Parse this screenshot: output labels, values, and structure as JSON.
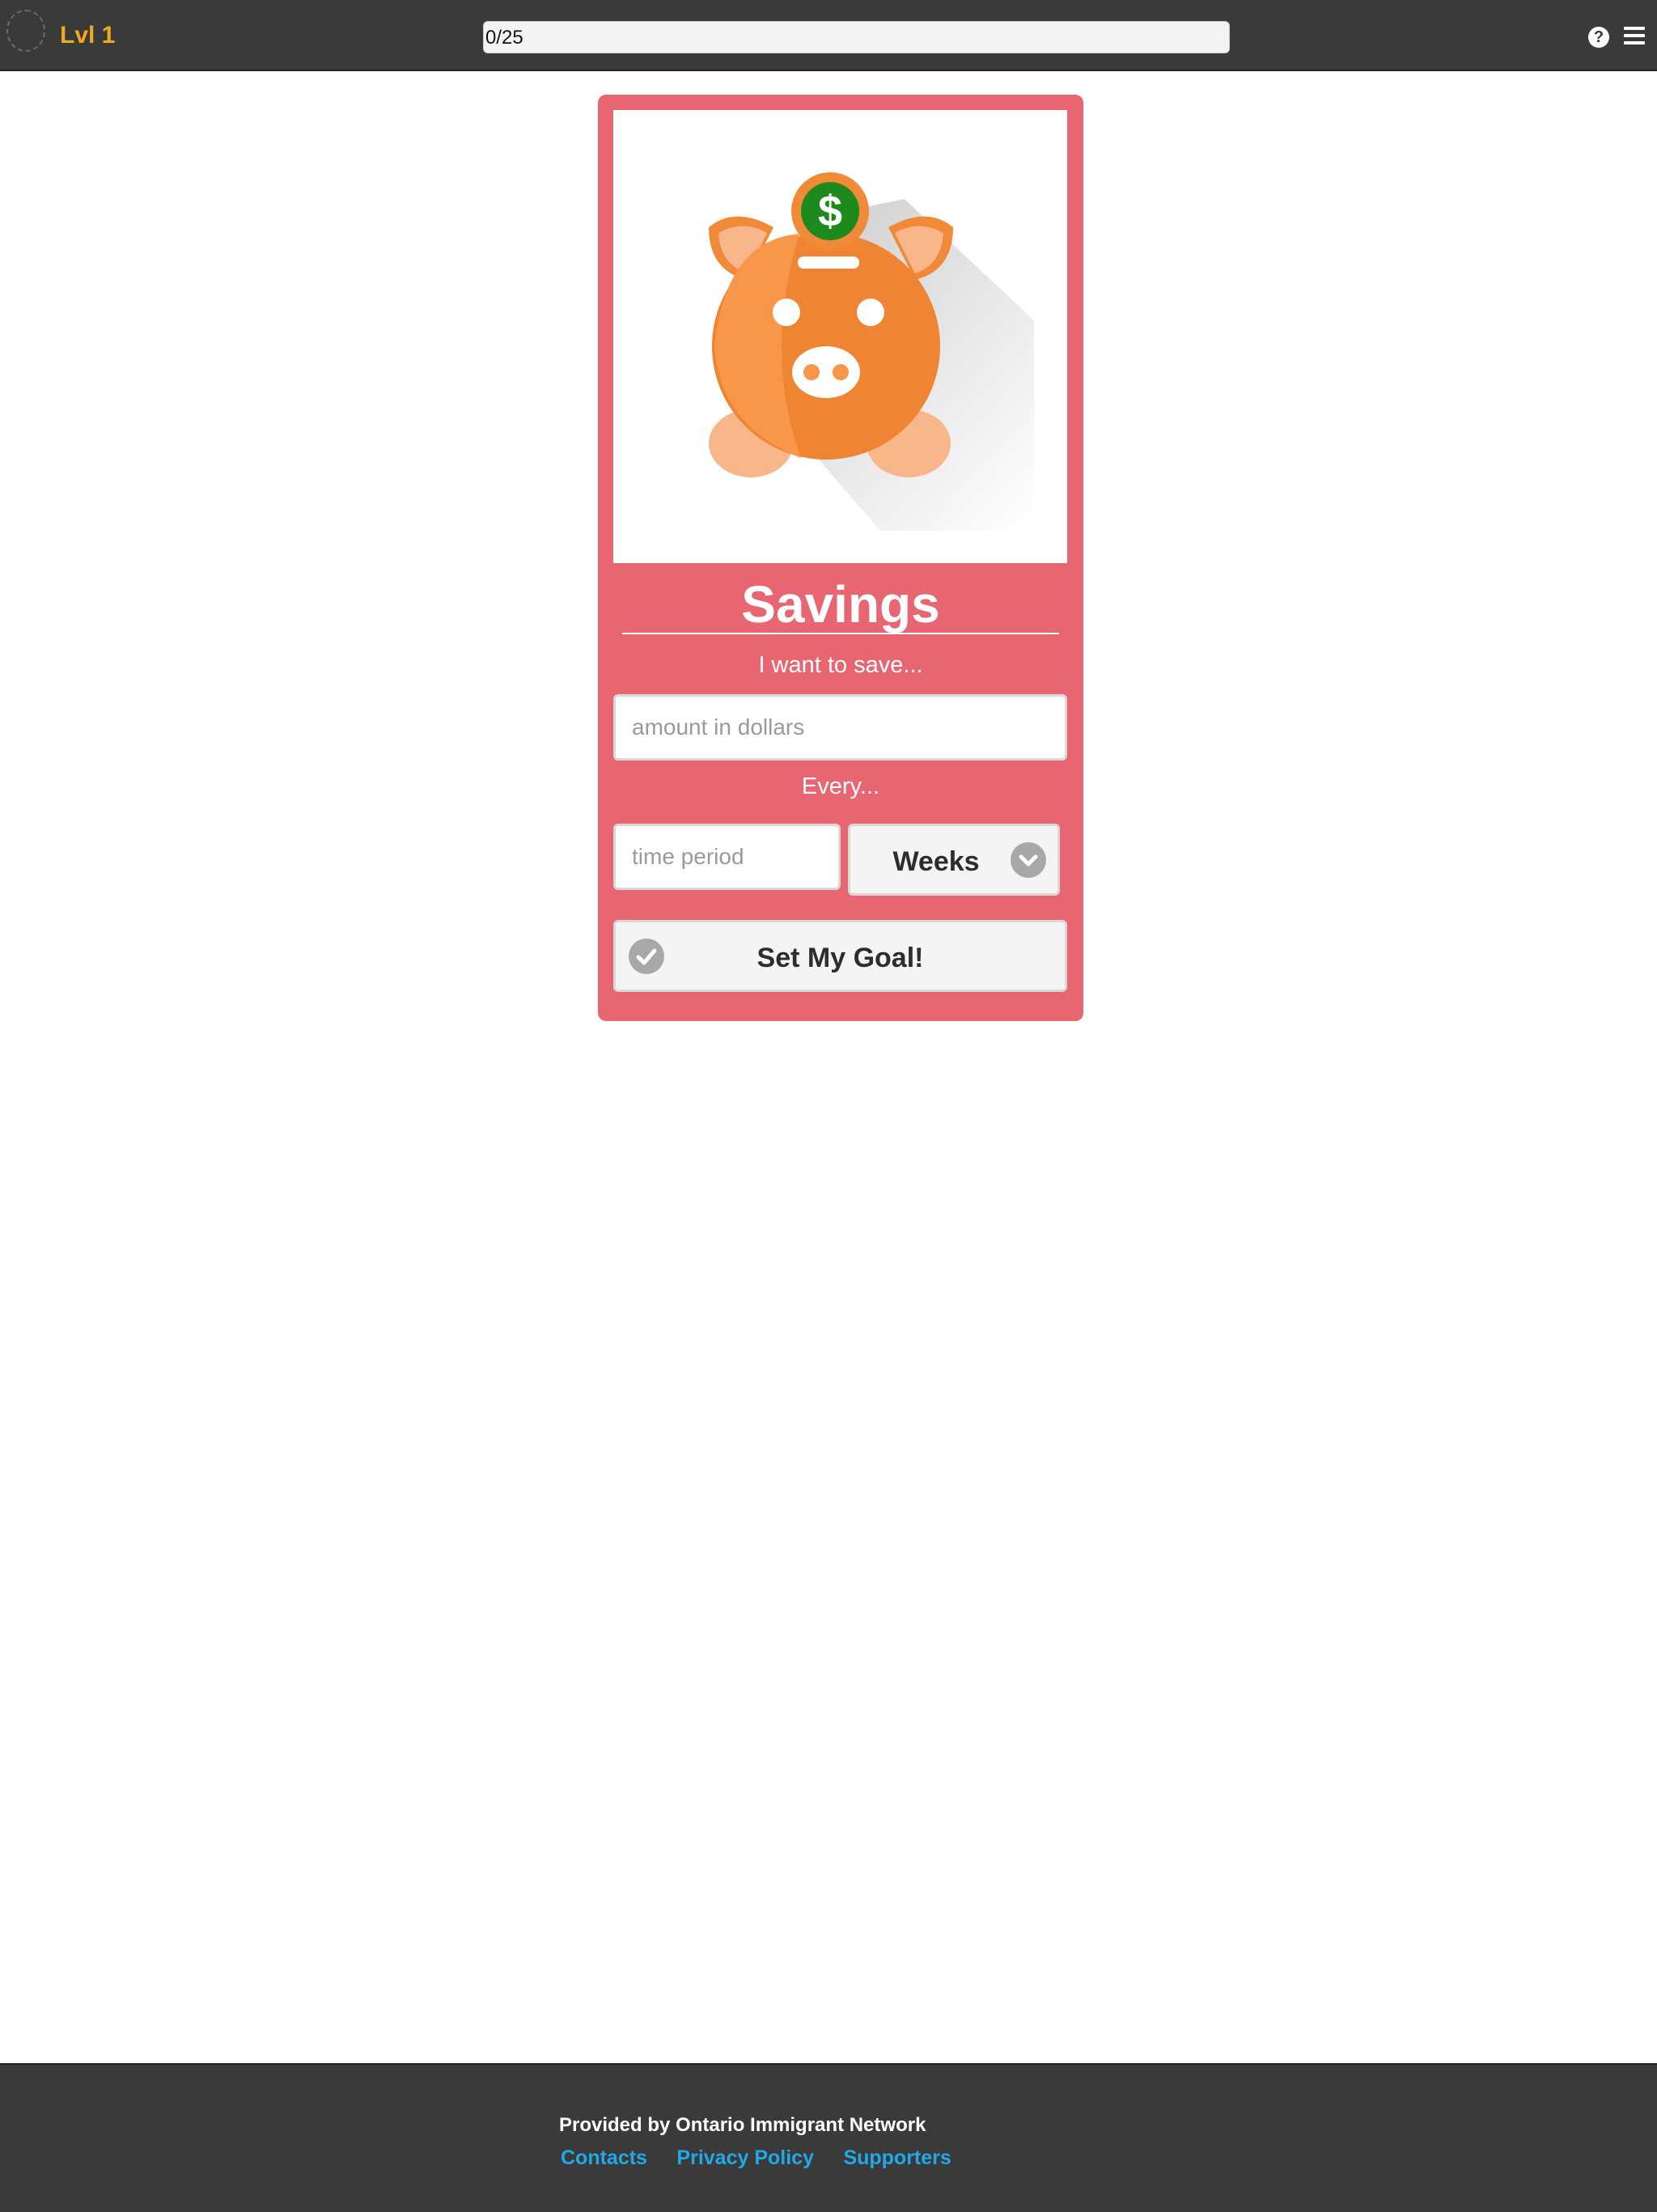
{
  "header": {
    "level_label": "Lvl 1",
    "progress_text": "0/25",
    "progress_fraction": 0.0,
    "help_icon": "question-circle-icon",
    "menu_icon": "hamburger-menu-icon"
  },
  "card": {
    "image_icon": "piggy-bank-dollar-icon",
    "title": "Savings",
    "save_prompt": "I want to save...",
    "amount_placeholder": "amount in dollars",
    "every_prompt": "Every...",
    "period_placeholder": "time period",
    "period_unit_selected": "Weeks",
    "submit_label": "Set My Goal!"
  },
  "footer": {
    "provided_by": "Provided by Ontario Immigrant Network",
    "links": [
      "Contacts",
      "Privacy Policy",
      "Supporters"
    ]
  },
  "colors": {
    "topbar": "#3a3a3a",
    "level_text": "#f0a81c",
    "card_background": "#e76672",
    "pig_orange": "#f7964a",
    "coin_green": "#1e8a1e",
    "link_blue": "#21a8e6"
  }
}
